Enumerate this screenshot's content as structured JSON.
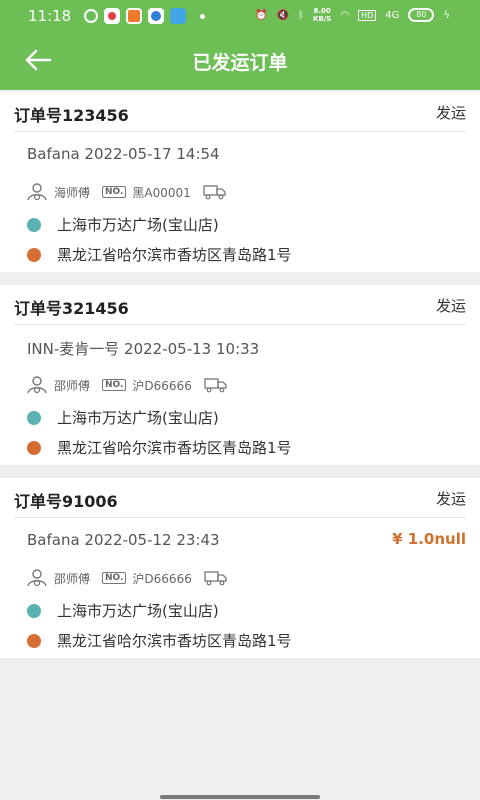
{
  "status_bar": {
    "time": "11:18",
    "net_speed": "8.00",
    "net_unit": "KB/S",
    "hd": "HD",
    "signal": "4G",
    "battery": "80"
  },
  "header": {
    "title": "已发运订单"
  },
  "orders": [
    {
      "order_no": "订单号123456",
      "status": "发运",
      "meta": "Bafana 2022-05-17 14:54",
      "price": "",
      "driver": "海师傅",
      "plate": "黑A00001",
      "no_label": "NO.",
      "from": "上海市万达广场(宝山店)",
      "to": "黑龙江省哈尔滨市香坊区青岛路1号"
    },
    {
      "order_no": "订单号321456",
      "status": "发运",
      "meta": "INN-麦肯一号 2022-05-13 10:33",
      "price": "",
      "driver": "邵师傅",
      "plate": "沪D66666",
      "no_label": "NO.",
      "from": "上海市万达广场(宝山店)",
      "to": "黑龙江省哈尔滨市香坊区青岛路1号"
    },
    {
      "order_no": "订单号91006",
      "status": "发运",
      "meta": "Bafana 2022-05-12 23:43",
      "price": "¥ 1.0null",
      "driver": "邵师傅",
      "plate": "沪D66666",
      "no_label": "NO.",
      "from": "上海市万达广场(宝山店)",
      "to": "黑龙江省哈尔滨市香坊区青岛路1号"
    }
  ],
  "colors": {
    "primary": "#6cbe55",
    "from_dot": "#5ab3b0",
    "to_dot": "#d66d35",
    "price": "#d0712e"
  }
}
